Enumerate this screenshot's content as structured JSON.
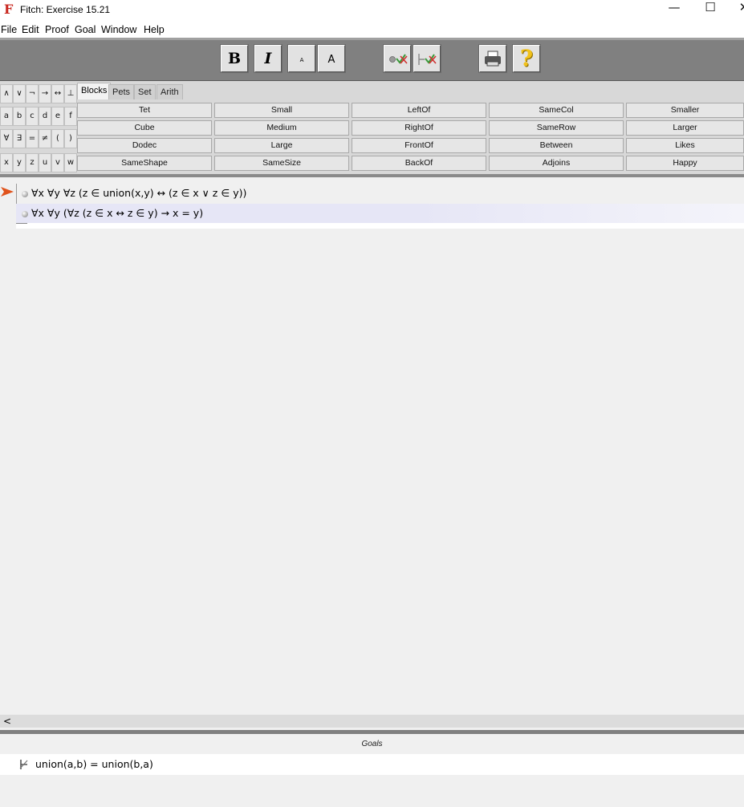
{
  "window": {
    "title": "Fitch: Exercise 15.21",
    "icon": "fitch-app-icon",
    "minimize": "—",
    "maximize": "☐",
    "close": "✕"
  },
  "menu": [
    "File",
    "Edit",
    "Proof",
    "Goal",
    "Window",
    "Help"
  ],
  "toolbar": {
    "bold": "B",
    "italic": "I",
    "small_font": "A",
    "large_font": "A",
    "verify_icon": "check-step-icon",
    "verify_proof_icon": "check-proof-icon",
    "print_icon": "printer-icon",
    "help": "?"
  },
  "symbols": {
    "row1": [
      "∧",
      "∨",
      "¬",
      "→",
      "↔",
      "⊥"
    ],
    "row2": [
      "a",
      "b",
      "c",
      "d",
      "e",
      "f"
    ],
    "row3": [
      "∀",
      "∃",
      "=",
      "≠",
      "(",
      ")"
    ],
    "row4": [
      "x",
      "y",
      "z",
      "u",
      "v",
      "w"
    ]
  },
  "tabs": [
    "Blocks",
    "Pets",
    "Set",
    "Arith"
  ],
  "predicates": {
    "row1": [
      "Tet",
      "Small",
      "LeftOf",
      "SameCol",
      "Smaller"
    ],
    "row2": [
      "Cube",
      "Medium",
      "RightOf",
      "SameRow",
      "Larger"
    ],
    "row3": [
      "Dodec",
      "Large",
      "FrontOf",
      "Between",
      "Likes"
    ],
    "row4": [
      "SameShape",
      "SameSize",
      "BackOf",
      "Adjoins",
      "Happy"
    ]
  },
  "proof": {
    "premises": [
      "∀x ∀y ∀z  (z ∈ union(x,y)  ↔ (z ∈ x ∨ z ∈ y))",
      "∀x ∀y (∀z  (z ∈ x ↔ z ∈ y) → x = y)"
    ]
  },
  "scroll": {
    "left_arrow": "<"
  },
  "goals": {
    "header": "Goals",
    "items": [
      "union(a,b) = union(b,a)"
    ],
    "icon": "goal-turnstile-icon"
  },
  "colors": {
    "toolbar": "#808080",
    "pointer": "#e0531c",
    "selected_row": "#e6e6f6",
    "app_icon": "#c8261e"
  }
}
